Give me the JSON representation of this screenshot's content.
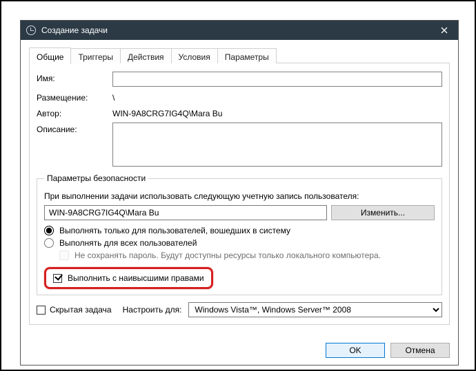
{
  "window": {
    "title": "Создание задачи",
    "close_tooltip": "Закрыть"
  },
  "tabs": {
    "general": "Общие",
    "triggers": "Триггеры",
    "actions": "Действия",
    "conditions": "Условия",
    "settings": "Параметры"
  },
  "general": {
    "name_label": "Имя:",
    "name_value": "",
    "location_label": "Размещение:",
    "location_value": "\\",
    "author_label": "Автор:",
    "author_value": "WIN-9A8CRG7IG4Q\\Mara Bu",
    "description_label": "Описание:",
    "description_value": ""
  },
  "security": {
    "legend": "Параметры безопасности",
    "account_intro": "При выполнении задачи использовать следующую учетную запись пользователя:",
    "account_value": "WIN-9A8CRG7IG4Q\\Mara Bu",
    "change_button": "Изменить...",
    "run_logged_on": "Выполнять только для пользователей, вошедших в систему",
    "run_all_users": "Выполнять для всех пользователей",
    "no_store_password": "Не сохранять пароль. Будут доступны ресурсы только локального компьютера.",
    "run_highest": "Выполнить с наивысшими правами"
  },
  "bottom": {
    "hidden_task": "Скрытая задача",
    "configure_for_label": "Настроить для:",
    "configure_for_value": "Windows Vista™, Windows Server™ 2008"
  },
  "buttons": {
    "ok": "OK",
    "cancel": "Отмена"
  }
}
